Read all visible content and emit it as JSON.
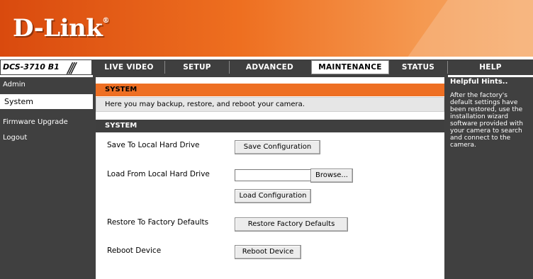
{
  "brand": {
    "logo": "D-Link",
    "mark": "®",
    "model": "DCS-3710 B1",
    "slashes": "///"
  },
  "nav": {
    "tabs": [
      {
        "label": "LIVE VIDEO"
      },
      {
        "label": "SETUP"
      },
      {
        "label": "ADVANCED"
      },
      {
        "label": "MAINTENANCE",
        "active": true
      },
      {
        "label": "STATUS"
      },
      {
        "label": "HELP"
      }
    ]
  },
  "sidebar": {
    "items": [
      {
        "label": "Admin"
      },
      {
        "label": "System",
        "active": true
      },
      {
        "label": "Firmware Upgrade"
      },
      {
        "label": "Logout"
      }
    ]
  },
  "main": {
    "section_title": "SYSTEM",
    "description": "Here you may backup, restore, and reboot your camera.",
    "subsection_title": "SYSTEM",
    "rows": {
      "save_label": "Save To Local Hard Drive",
      "save_button": "Save Configuration",
      "load_label": "Load From Local Hard Drive",
      "file_value": "",
      "browse_button": "Browse...",
      "load_button": "Load Configuration",
      "restore_label": "Restore To Factory Defaults",
      "restore_button": "Restore Factory Defaults",
      "reboot_label": "Reboot Device",
      "reboot_button": "Reboot Device"
    }
  },
  "hints": {
    "title": "Helpful Hints..",
    "body": "After the factory's default settings have been restored, use the installation wizard software provided with your camera to search and connect to the camera."
  },
  "colors": {
    "accent": "#ee6f23",
    "dark": "#404040",
    "panel": "#e6e6e6"
  }
}
